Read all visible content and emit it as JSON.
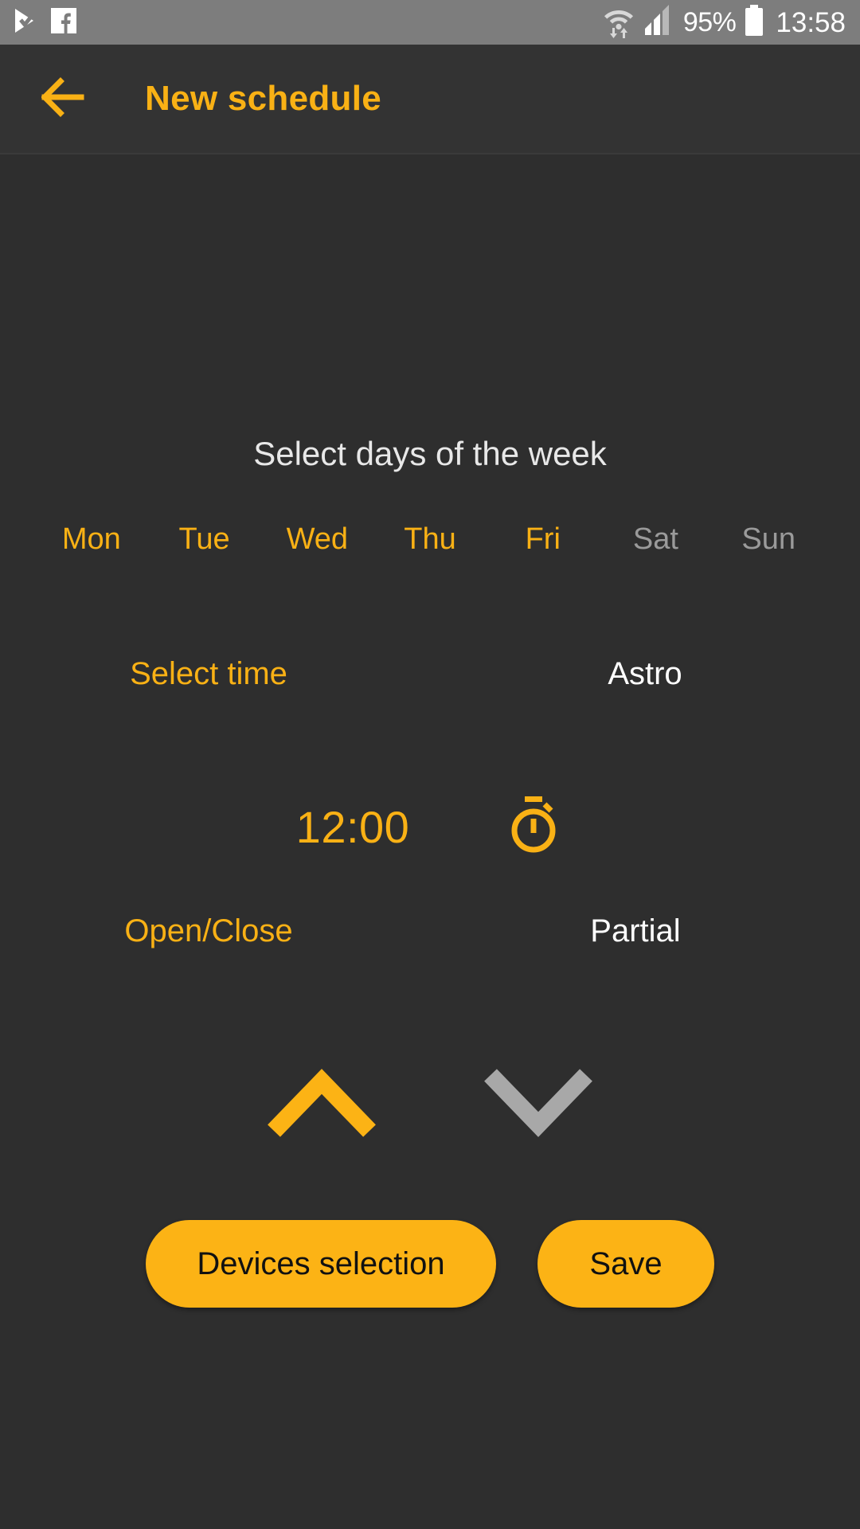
{
  "status_bar": {
    "left_icons": [
      {
        "name": "play-store-update-icon",
        "label": "Play Store"
      },
      {
        "name": "facebook-icon",
        "label": "Facebook"
      }
    ],
    "wifi_icon": "wifi-transfer-icon",
    "signal_icon": "cellular-signal-icon",
    "battery_percent": "95%",
    "battery_icon": "battery-full-icon",
    "clock": "13:58"
  },
  "app_bar": {
    "back_icon": "back-arrow-icon",
    "title": "New schedule"
  },
  "days_section": {
    "title": "Select days of the week",
    "days": [
      {
        "label": "Mon",
        "selected": true
      },
      {
        "label": "Tue",
        "selected": true
      },
      {
        "label": "Wed",
        "selected": true
      },
      {
        "label": "Thu",
        "selected": true
      },
      {
        "label": "Fri",
        "selected": true
      },
      {
        "label": "Sat",
        "selected": false
      },
      {
        "label": "Sun",
        "selected": false
      }
    ]
  },
  "time_section": {
    "tabs": [
      {
        "label": "Select time",
        "selected": true
      },
      {
        "label": "Astro",
        "selected": false
      }
    ],
    "time_value": "12:00",
    "timer_icon": "stopwatch-icon"
  },
  "action_section": {
    "tabs": [
      {
        "label": "Open/Close",
        "selected": true
      },
      {
        "label": "Partial",
        "selected": false
      }
    ],
    "arrows": [
      {
        "name": "chevron-up-icon",
        "direction": "up",
        "selected": true
      },
      {
        "name": "chevron-down-icon",
        "direction": "down",
        "selected": false
      }
    ]
  },
  "buttons": {
    "devices_label": "Devices selection",
    "save_label": "Save"
  },
  "colors": {
    "accent": "#f9b115",
    "button": "#fcb315",
    "background": "#2e2e2e",
    "app_bar": "#333333",
    "status_bar": "#7d7d7d",
    "inactive": "#9a9a9a",
    "active_text": "#ffffff"
  }
}
